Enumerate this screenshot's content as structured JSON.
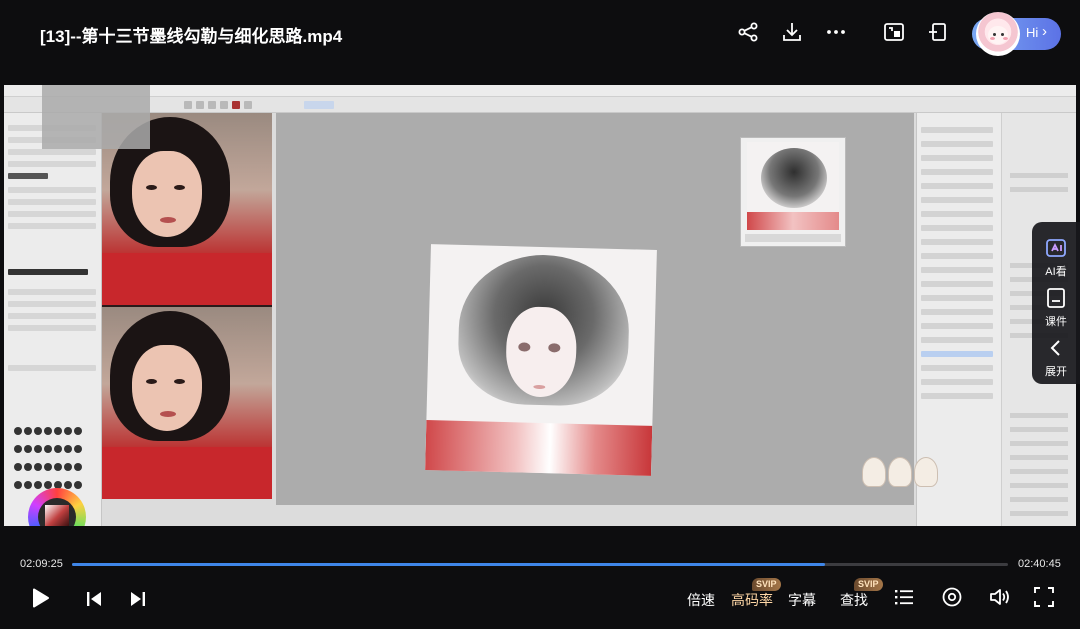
{
  "header": {
    "title": "[13]--第十三节墨线勾勒与细化思路.mp4",
    "actions": [
      "share-icon",
      "download-icon",
      "more-icon",
      "picture-in-picture-icon",
      "pin-window-icon"
    ],
    "user": {
      "greeting": "Hi",
      "chevron": "›"
    }
  },
  "side_bar": {
    "items": [
      {
        "label": "AI看",
        "icon": "ai-watch-icon"
      },
      {
        "label": "课件",
        "icon": "courseware-icon"
      },
      {
        "label": "展开",
        "icon": "chevron-left-icon"
      }
    ]
  },
  "player": {
    "current_time": "02:09:25",
    "total_time": "02:40:45",
    "progress": 0.805,
    "controls": {
      "speed": "倍速",
      "quality": "高码率",
      "quality_badge": "SVIP",
      "subtitle": "字幕",
      "search": "查找",
      "search_badge": "SVIP"
    },
    "icons": [
      "play-icon",
      "previous-icon",
      "next-icon",
      "playlist-icon",
      "settings-icon",
      "volume-icon",
      "fullscreen-icon"
    ]
  },
  "colors": {
    "background": "#0d0d0f",
    "progress": "#3f86e8",
    "accent_quality": "#ffd7a6",
    "user_pill_start": "#7aa7f2",
    "user_pill_end": "#5c72e6"
  }
}
